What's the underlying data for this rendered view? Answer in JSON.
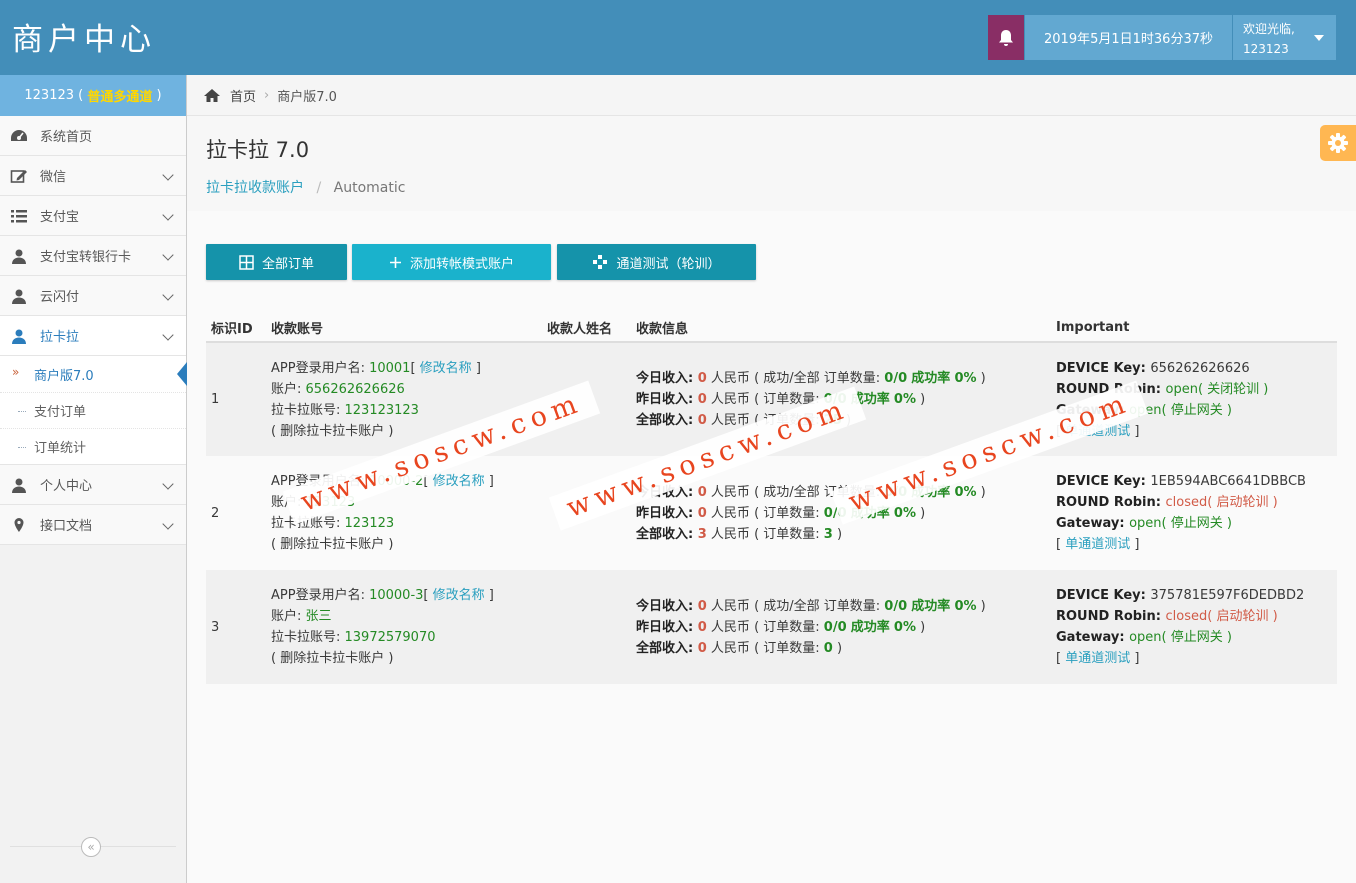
{
  "header": {
    "brand": "商户中心",
    "datetime": "2019年5月1日1时36分37秒",
    "welcome": "欢迎光临,",
    "username": "123123"
  },
  "sidebar": {
    "user_id": "123123",
    "user_open": " ( ",
    "user_level": "普通多通道",
    "user_close": " )",
    "items": [
      {
        "label": "系统首页",
        "icon": "dashboard-icon"
      },
      {
        "label": "微信",
        "icon": "edit-icon"
      },
      {
        "label": "支付宝",
        "icon": "list-icon"
      },
      {
        "label": "支付宝转银行卡",
        "icon": "user-icon"
      },
      {
        "label": "云闪付",
        "icon": "user-icon"
      },
      {
        "label": "拉卡拉",
        "icon": "user-icon"
      },
      {
        "label": "个人中心",
        "icon": "user-icon"
      },
      {
        "label": "接口文档",
        "icon": "map-marker-icon"
      }
    ],
    "subitems": [
      "商户版7.0",
      "支付订单",
      "订单统计"
    ],
    "collapse_glyph": "«"
  },
  "breadcrumb": {
    "home": "首页",
    "current": "商户版7.0"
  },
  "page": {
    "title": "拉卡拉 7.0",
    "sub_link": "拉卡拉收款账户",
    "sub_current": "Automatic"
  },
  "buttons": {
    "all_orders": "全部订单",
    "add_account": "添加转帐模式账户",
    "channel_test": "通道测试（轮训）"
  },
  "table": {
    "headers": [
      "标识ID",
      "收款账号",
      "收款人姓名",
      "收款信息",
      "Important"
    ],
    "labels": {
      "app_login": "APP登录用户名: ",
      "rename": "修改名称",
      "account": "账户: ",
      "lkl_account": "拉卡拉账号: ",
      "delete": "( 删除拉卡拉卡账户 )",
      "today": "今日收入: ",
      "yesterday": "昨日收入: ",
      "total": "全部收入: ",
      "rmb": " 人民币",
      "success_all": "( 成功/全部 订单数量: ",
      "order_count": "( 订单数量: ",
      "success_rate": "成功率",
      "close_paren": " )",
      "device_key": "DEVICE Key: ",
      "round_robin": "ROUND Robin: ",
      "gateway": "Gateway: ",
      "single_test": "单通道测试",
      "stop_gateway": "( 停止网关 )"
    },
    "rows": [
      {
        "id": "1",
        "app_user": "10001",
        "account": "656262626626",
        "lkl_account": "123123123",
        "today": "0",
        "today_ratio": "0/0",
        "today_rate": "0%",
        "yesterday": "0",
        "yesterday_ratio": "0/0",
        "yesterday_rate": "0%",
        "total": "0",
        "total_count": "25",
        "device_key": "656262626626",
        "round_robin": "open",
        "rr_action": "( 关闭轮训 )",
        "gateway": "open"
      },
      {
        "id": "2",
        "app_user": "10000-2",
        "account": "123123",
        "lkl_account": "123123",
        "today": "0",
        "today_ratio": "0/0",
        "today_rate": "0%",
        "yesterday": "0",
        "yesterday_ratio": "0/0",
        "yesterday_rate": "0%",
        "total": "3",
        "total_count": "3",
        "device_key": "1EB594ABC6641DBBCB",
        "round_robin": "closed",
        "rr_action": "( 启动轮训 )",
        "gateway": "open"
      },
      {
        "id": "3",
        "app_user": "10000-3",
        "account": "张三",
        "lkl_account": "13972579070",
        "today": "0",
        "today_ratio": "0/0",
        "today_rate": "0%",
        "yesterday": "0",
        "yesterday_ratio": "0/0",
        "yesterday_rate": "0%",
        "total": "0",
        "total_count": "0",
        "device_key": "375781E597F6DEDBD2",
        "round_robin": "closed",
        "rr_action": "( 启动轮训 )",
        "gateway": "open"
      }
    ]
  },
  "watermark": "www.soscw.com",
  "colors": {
    "header": "#438eb9",
    "bell": "#892e65",
    "accent": "#1593aa",
    "green": "#248a24",
    "red": "#d15b47"
  }
}
